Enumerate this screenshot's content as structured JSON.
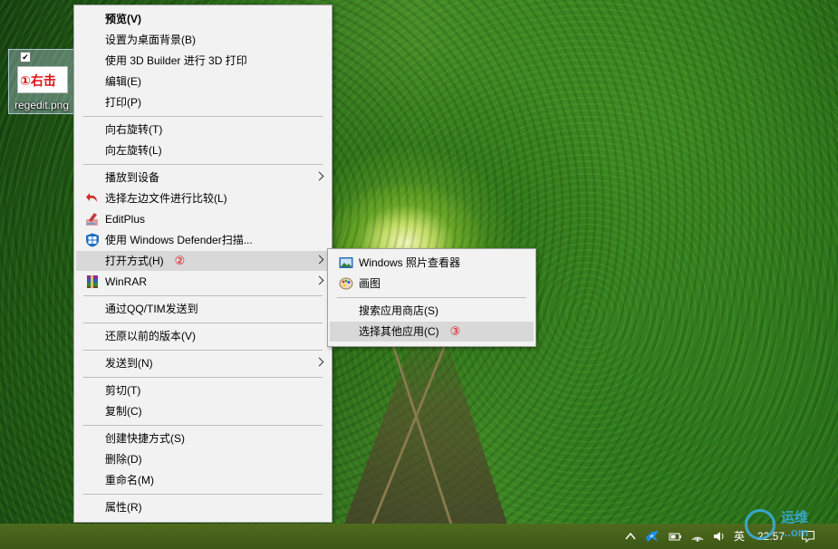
{
  "desktop": {
    "icon": {
      "filename": "regedit.png",
      "annotation": "①右击",
      "checked": true
    }
  },
  "context_menu": {
    "items": [
      {
        "label": "预览(V)",
        "bold": true
      },
      {
        "label": "设置为桌面背景(B)"
      },
      {
        "label": "使用 3D Builder 进行 3D 打印"
      },
      {
        "label": "编辑(E)"
      },
      {
        "label": "打印(P)"
      },
      {
        "label": "向右旋转(T)"
      },
      {
        "label": "向左旋转(L)"
      },
      {
        "label": "播放到设备",
        "submenu": true
      },
      {
        "label": "选择左边文件进行比较(L)",
        "icon": "compare-arrow-icon"
      },
      {
        "label": "EditPlus",
        "icon": "editplus-icon"
      },
      {
        "label": "使用 Windows Defender扫描...",
        "icon": "windows-defender-shield-icon"
      },
      {
        "label": "打开方式(H)",
        "submenu": true,
        "highlighted": true,
        "step": "②"
      },
      {
        "label": "WinRAR",
        "submenu": true,
        "icon": "winrar-icon"
      },
      {
        "label": "通过QQ/TIM发送到"
      },
      {
        "label": "还原以前的版本(V)"
      },
      {
        "label": "发送到(N)",
        "submenu": true
      },
      {
        "label": "剪切(T)"
      },
      {
        "label": "复制(C)"
      },
      {
        "label": "创建快捷方式(S)"
      },
      {
        "label": "删除(D)"
      },
      {
        "label": "重命名(M)"
      },
      {
        "label": "属性(R)"
      }
    ]
  },
  "open_with_submenu": {
    "items": [
      {
        "label": "Windows 照片查看器",
        "icon": "photo-viewer-icon"
      },
      {
        "label": "画图",
        "icon": "paint-icon"
      },
      {
        "label": "搜索应用商店(S)"
      },
      {
        "label": "选择其他应用(C)",
        "highlighted": true,
        "step": "③"
      }
    ]
  },
  "taskbar": {
    "ime_label": "英",
    "time": "22:57"
  },
  "watermark": {
    "line1": "运维",
    "line2": "...om"
  }
}
